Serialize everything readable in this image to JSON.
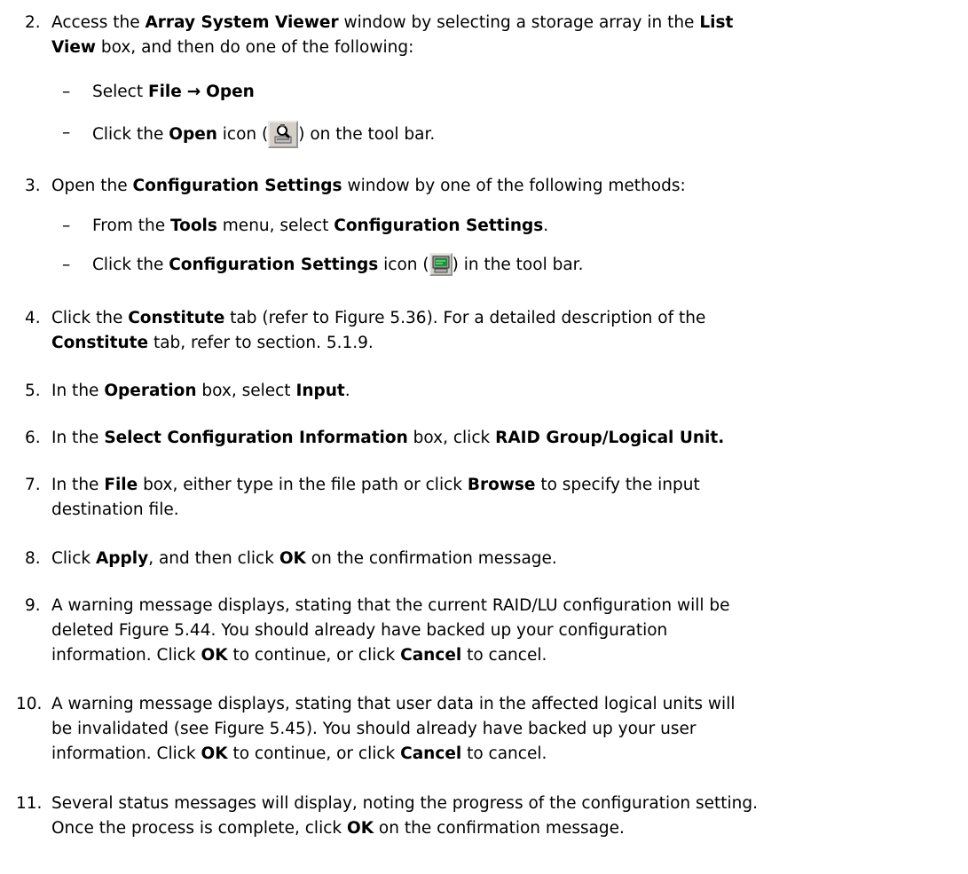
{
  "steps": {
    "s2": {
      "num": "2.",
      "a": "Access the ",
      "b": "Array System Viewer",
      "c": " window by selecting a storage array in the ",
      "d": "List",
      "e": "View",
      "f": " box, and then do one of the following:",
      "sub1": {
        "a": "Select ",
        "b": "File",
        "c": "Open"
      },
      "sub2": {
        "a": "Click the ",
        "b": "Open",
        "c": " icon (",
        "d": ") on the tool bar."
      }
    },
    "s3": {
      "num": "3.",
      "a": "Open the ",
      "b": "Configuration Settings",
      "c": " window by one of the following methods:",
      "sub1": {
        "a": "From the ",
        "b": "Tools",
        "c": " menu, select ",
        "d": "Configuration Settings",
        "e": "."
      },
      "sub2": {
        "a": "Click the ",
        "b": "Configuration Settings",
        "c": " icon (",
        "d": ") in the tool bar."
      }
    },
    "s4": {
      "num": "4.",
      "a": "Click the ",
      "b": "Constitute",
      "c": " tab (refer to Figure 5.36). For a detailed description of the",
      "d": "Constitute",
      "e": " tab, refer to section. 5.1.9."
    },
    "s5": {
      "num": "5.",
      "a": "In the ",
      "b": "Operation",
      "c": " box, select ",
      "d": "Input",
      "e": "."
    },
    "s6": {
      "num": "6.",
      "a": "In the ",
      "b": "Select Configuration Information",
      "c": " box, click ",
      "d": "RAID Group/Logical Unit."
    },
    "s7": {
      "num": "7.",
      "a": "In the ",
      "b": "File",
      "c": " box, either type in the file path or click ",
      "d": "Browse",
      "e": " to specify the input",
      "line2": "destination file."
    },
    "s8": {
      "num": "8.",
      "a": "Click ",
      "b": "Apply",
      "c": ", and then click ",
      "d": "OK",
      "e": " on the confirmation message."
    },
    "s9": {
      "num": "9.",
      "line1": "A warning message displays, stating that the current RAID/LU configuration will be",
      "line2": "deleted Figure 5.44. You should already have backed up your configuration",
      "a": "information. Click ",
      "b": "OK",
      "c": " to continue, or click ",
      "d": "Cancel",
      "e": " to cancel."
    },
    "s10": {
      "num": "10.",
      "line1": "A warning message displays, stating that user data in the affected logical units will",
      "line2": "be invalidated (see Figure 5.45). You should already have backed up your user",
      "a": "information. Click ",
      "b": "OK",
      "c": " to continue, or click ",
      "d": "Cancel",
      "e": " to cancel."
    },
    "s11": {
      "num": "11.",
      "line1": "Several status messages will display, noting the progress of the configuration setting.",
      "a": "Once the process is complete, click ",
      "b": "OK",
      "c": " on the confirmation message."
    }
  },
  "icons": {
    "arrow": "right-arrow-icon",
    "open": "open-magnifier-icon",
    "config": "configuration-settings-icon"
  }
}
